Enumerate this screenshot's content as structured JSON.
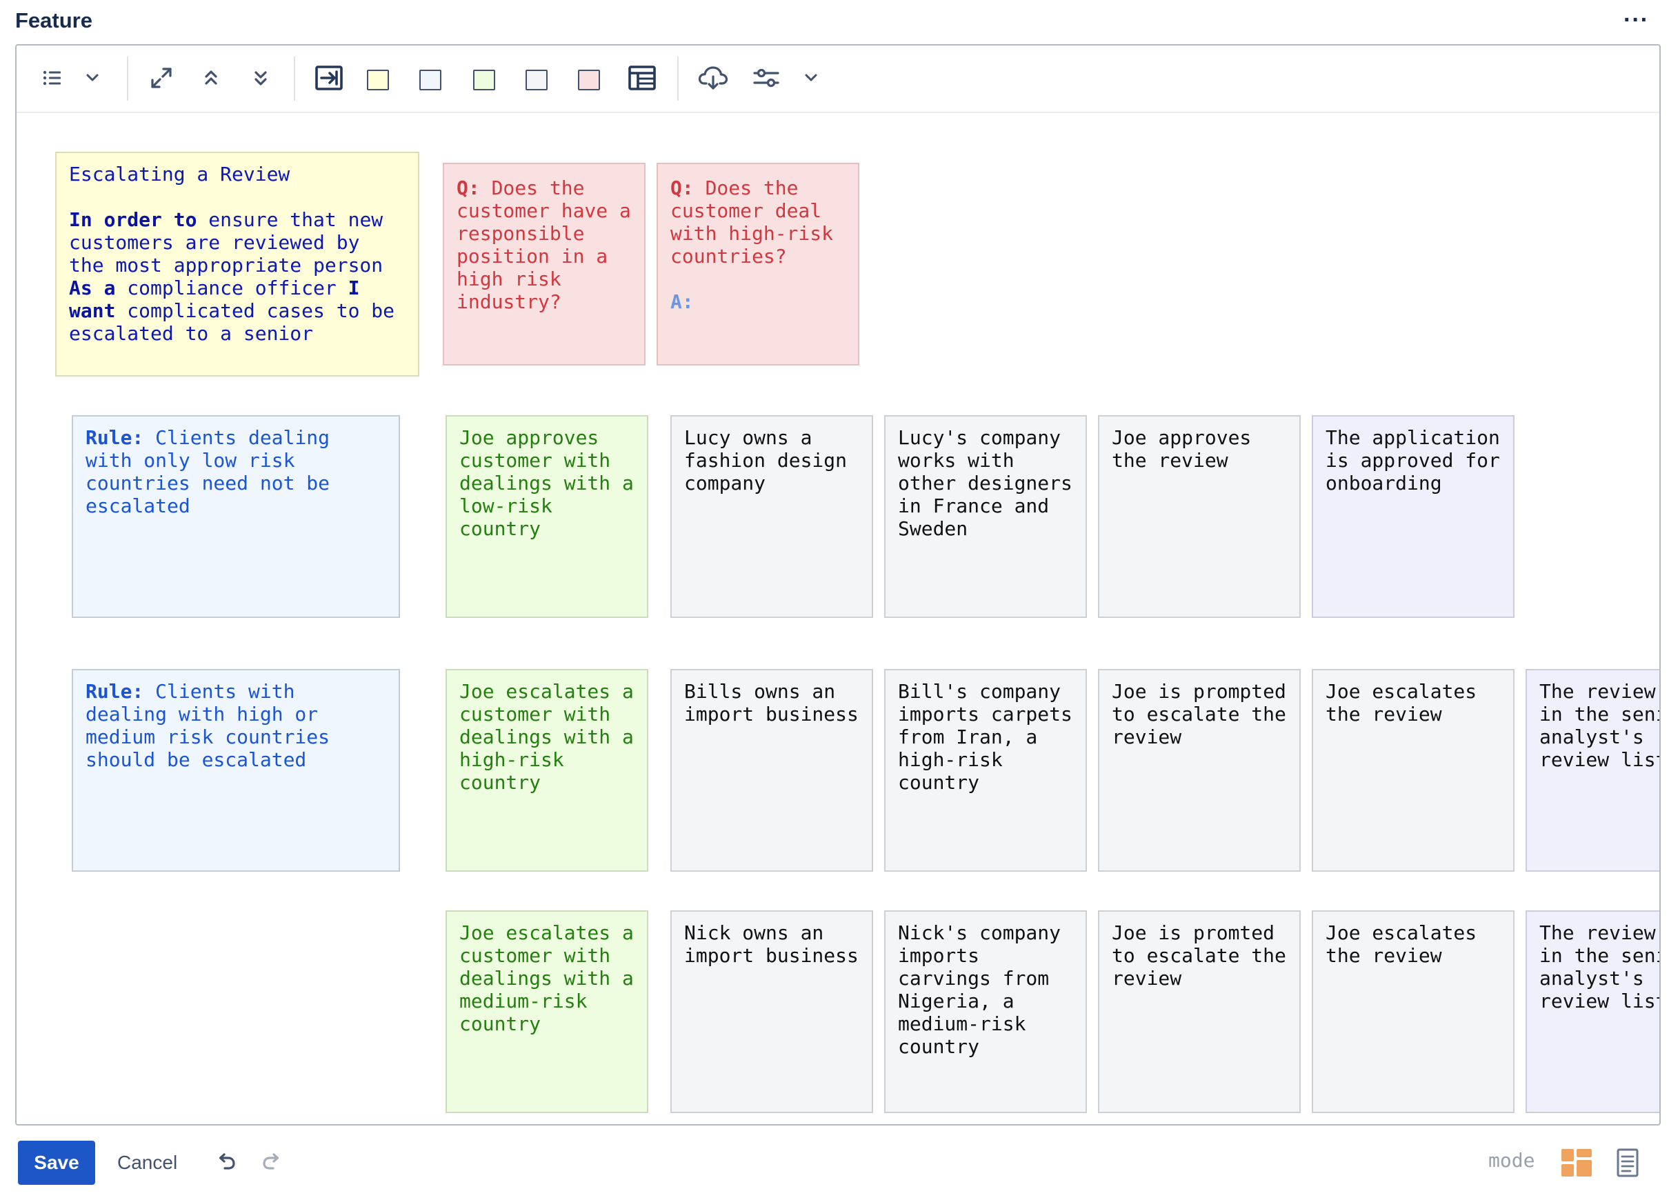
{
  "header": {
    "title": "Feature",
    "more_label": "···"
  },
  "toolbar": {
    "icons": [
      "list-icon",
      "chevron-down-icon",
      "expand-icon",
      "collapse-up-icon",
      "expand-down-icon",
      "insert-into-icon",
      "table-icon",
      "cloud-download-icon",
      "settings-sliders-icon",
      "chevron-down-icon"
    ],
    "swatch_colors": [
      "#fffed8",
      "#eff6fe",
      "#eefce0",
      "#f4f5f7",
      "#fae1e1"
    ]
  },
  "cards": {
    "feature": {
      "title": "Escalating a Review",
      "in_order_to_kw": "In order to",
      "in_order_to_text": " ensure that new customers are reviewed by the most appropriate person",
      "as_a_kw": "As a",
      "as_a_text": " compliance officer ",
      "i_want_kw": "I want",
      "i_want_text": " complicated cases to be escalated to a senior"
    },
    "question1": {
      "q_kw": "Q:",
      "text": " Does the customer have a responsible position in a high risk industry?"
    },
    "question2": {
      "q_kw": "Q:",
      "text": " Does the customer deal with high-risk countries?",
      "a_kw": "A:"
    },
    "rule1": {
      "kw": "Rule:",
      "text": " Clients dealing with only low risk countries need not be escalated"
    },
    "rule2": {
      "kw": "Rule:",
      "text": " Clients with dealing with high or medium risk countries should be escalated"
    },
    "row1": [
      "Joe approves customer with dealings with a low-risk country",
      "Lucy owns a fashion design company",
      "Lucy's company works with other designers in France and Sweden",
      "Joe approves the review",
      "The application is approved for onboarding"
    ],
    "row2": [
      "Joe escalates a customer with dealings with a high-risk country",
      "Bills owns an import business",
      "Bill's company imports carpets from Iran, a high-risk country",
      "Joe is prompted to escalate the review",
      "Joe escalates the review",
      "The review is in the senior analyst's review list"
    ],
    "row3": [
      "Joe escalates a customer with dealings with a medium-risk country",
      "Nick owns an import business",
      "Nick's company imports carvings from Nigeria, a medium-risk country",
      "Joe is promted to escalate the review",
      "Joe escalates the review",
      "The review is in the senior analyst's review list"
    ]
  },
  "footer": {
    "save_label": "Save",
    "cancel_label": "Cancel",
    "mode_label": "mode"
  },
  "colors": {
    "accent": "#1d56c7",
    "mode_grid": "#f0a35e"
  }
}
